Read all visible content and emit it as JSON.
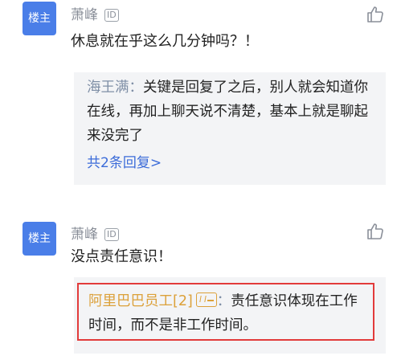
{
  "comments": [
    {
      "badge": "楼主",
      "user": "萧峰",
      "id_badge": "ID",
      "text": "休息就在乎这么几分钟吗？！",
      "replies": [
        {
          "author": "海王满",
          "separator": "：",
          "text": "关键是回复了之后，别人就会知道你在线，再加上聊天说不清楚，基本上就是聊起来没完了"
        }
      ],
      "more_replies": "共2条回复>"
    },
    {
      "badge": "楼主",
      "user": "萧峰",
      "id_badge": "ID",
      "text": "没点责任意识！",
      "replies": [
        {
          "author": "阿里巴巴员工[2]",
          "separator": "：",
          "text": "责任意识体现在工作时间，而不是非工作时间。",
          "badge_icon": "vip-card-icon"
        }
      ]
    }
  ],
  "colors": {
    "avatar_bg": "#4a7ee8",
    "link": "#3c6cd9",
    "highlight_border": "#e23b3b",
    "gold_author": "#dca13a",
    "reply_bg": "#f3f4f6"
  },
  "icons": {
    "like": "thumbs-up-icon"
  }
}
